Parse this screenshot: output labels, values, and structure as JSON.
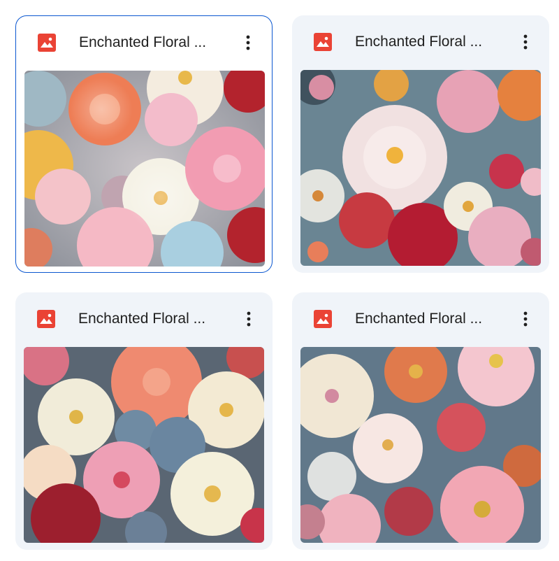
{
  "files": [
    {
      "name": "Enchanted Floral ...",
      "type_icon": "image-file-icon",
      "selected": true
    },
    {
      "name": "Enchanted Floral ...",
      "type_icon": "image-file-icon",
      "selected": false
    },
    {
      "name": "Enchanted Floral ...",
      "type_icon": "image-file-icon",
      "selected": false
    },
    {
      "name": "Enchanted Floral ...",
      "type_icon": "image-file-icon",
      "selected": false
    }
  ],
  "colors": {
    "icon_red": "#ea4335",
    "card_bg": "#f0f4f9",
    "selected_border": "#0b57d0",
    "text": "#1f1f1f"
  }
}
